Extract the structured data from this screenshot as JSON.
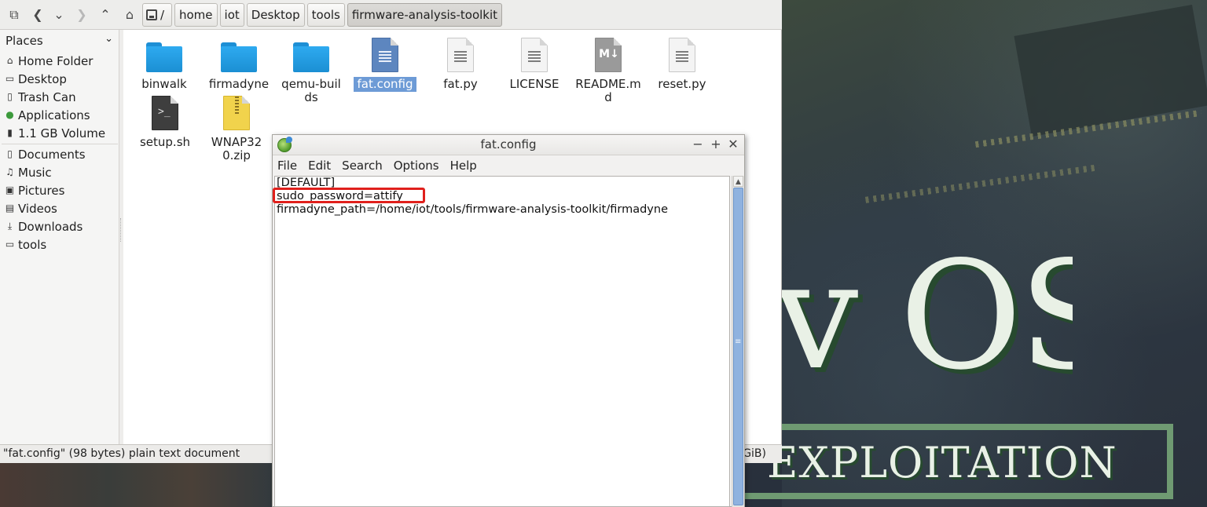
{
  "file_manager": {
    "toolbar": {
      "path": [
        {
          "label": "/"
        },
        {
          "label": "home"
        },
        {
          "label": "iot"
        },
        {
          "label": "Desktop"
        },
        {
          "label": "tools"
        },
        {
          "label": "firmware-analysis-toolkit"
        }
      ]
    },
    "sidebar": {
      "header": "Places",
      "items": [
        {
          "label": "Home Folder",
          "icon": "home-icon"
        },
        {
          "label": "Desktop",
          "icon": "desktop-icon"
        },
        {
          "label": "Trash Can",
          "icon": "trash-icon"
        },
        {
          "label": "Applications",
          "icon": "applications-icon"
        },
        {
          "label": "1.1 GB Volume",
          "icon": "usb-drive-icon"
        },
        {
          "label": "Documents",
          "icon": "documents-icon"
        },
        {
          "label": "Music",
          "icon": "music-icon"
        },
        {
          "label": "Pictures",
          "icon": "pictures-icon"
        },
        {
          "label": "Videos",
          "icon": "videos-icon"
        },
        {
          "label": "Downloads",
          "icon": "downloads-icon"
        },
        {
          "label": "tools",
          "icon": "folder-icon"
        }
      ]
    },
    "files": [
      {
        "name": "binwalk",
        "type": "folder"
      },
      {
        "name": "firmadyne",
        "type": "folder"
      },
      {
        "name": "qemu-builds",
        "type": "folder"
      },
      {
        "name": "fat.config",
        "type": "text-file",
        "selected": true
      },
      {
        "name": "fat.py",
        "type": "text-file"
      },
      {
        "name": "LICENSE",
        "type": "text-file"
      },
      {
        "name": "README.md",
        "type": "markdown-file"
      },
      {
        "name": "reset.py",
        "type": "text-file"
      },
      {
        "name": "setup.sh",
        "type": "shell-script"
      },
      {
        "name": "WNAP320.zip",
        "type": "zip-archive"
      }
    ],
    "status": {
      "text": "\"fat.config\" (98 bytes) plain text document",
      "right": "GiB)"
    },
    "selection_color": "#6d9bd6"
  },
  "editor": {
    "title": "fat.config",
    "menu": [
      "File",
      "Edit",
      "Search",
      "Options",
      "Help"
    ],
    "lines": [
      "[DEFAULT]",
      "sudo_password=attify",
      "firmadyne_path=/home/iot/tools/firmware-analysis-toolkit/firmadyne"
    ],
    "highlight_color": "#e0201c"
  },
  "wallpaper": {
    "big_text": "v OS",
    "sub_text": "EXPLOITATION",
    "accent": "#6f9a72"
  }
}
